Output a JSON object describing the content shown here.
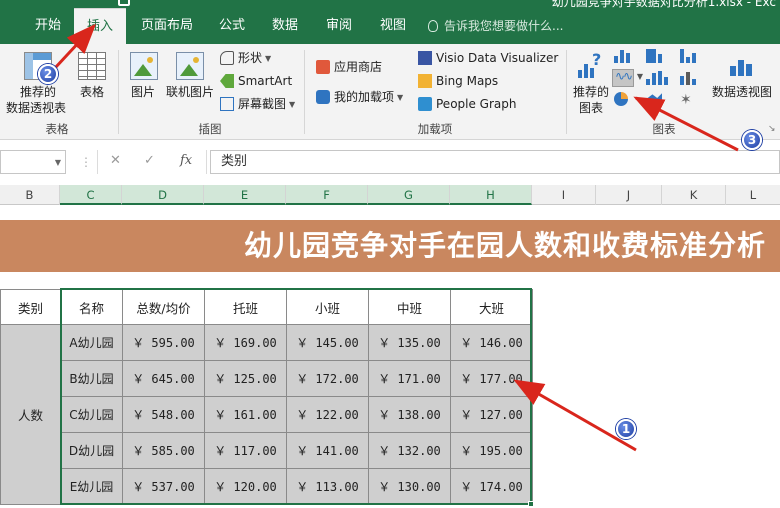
{
  "window": {
    "title": "幼儿园竞争对手数据对比分析1.xlsx - Exc"
  },
  "tabs": [
    "开始",
    "插入",
    "页面布局",
    "公式",
    "数据",
    "审阅",
    "视图"
  ],
  "active_tab": "插入",
  "tell_me": "告诉我您想要做什么...",
  "ribbon": {
    "tables": {
      "pivot_line1": "推荐的",
      "pivot_line2": "数据透视表",
      "table": "表格",
      "group": "表格"
    },
    "illustrations": {
      "picture": "图片",
      "online_picture": "联机图片",
      "shapes": "形状",
      "smartart": "SmartArt",
      "screenshot": "屏幕截图",
      "group": "插图"
    },
    "addins": {
      "store": "应用商店",
      "my_addins": "我的加载项",
      "visio": "Visio Data Visualizer",
      "bing": "Bing Maps",
      "people": "People Graph",
      "group": "加载项"
    },
    "charts": {
      "recommended_line1": "推荐的",
      "recommended_line2": "图表",
      "pivot_chart": "数据透视图",
      "group": "图表"
    }
  },
  "formula_bar": {
    "cell_ref": "",
    "content": "类别",
    "fx": "fx"
  },
  "columns": [
    "B",
    "C",
    "D",
    "E",
    "F",
    "G",
    "H",
    "I",
    "J",
    "K",
    "L"
  ],
  "banner": "幼儿园竞争对手在园人数和收费标准分析",
  "table": {
    "headers": [
      "类别",
      "名称",
      "总数/均价",
      "托班",
      "小班",
      "中班",
      "大班"
    ],
    "category": "人数",
    "rows": [
      {
        "name": "A幼儿园",
        "values": [
          "￥ 595.00",
          "￥ 169.00",
          "￥ 145.00",
          "￥ 135.00",
          "￥ 146.00"
        ]
      },
      {
        "name": "B幼儿园",
        "values": [
          "￥ 645.00",
          "￥ 125.00",
          "￥ 172.00",
          "￥ 171.00",
          "￥ 177.00"
        ]
      },
      {
        "name": "C幼儿园",
        "values": [
          "￥ 548.00",
          "￥ 161.00",
          "￥ 122.00",
          "￥ 138.00",
          "￥ 127.00"
        ]
      },
      {
        "name": "D幼儿园",
        "values": [
          "￥ 585.00",
          "￥ 117.00",
          "￥ 141.00",
          "￥ 132.00",
          "￥ 195.00"
        ]
      },
      {
        "name": "E幼儿园",
        "values": [
          "￥ 537.00",
          "￥ 120.00",
          "￥ 113.00",
          "￥ 130.00",
          "￥ 174.00"
        ]
      }
    ]
  },
  "annotations": [
    "1",
    "2",
    "3"
  ],
  "colors": {
    "excel_green": "#217346",
    "banner": "#c9875f",
    "cell_gray": "#cfcfcf",
    "arrow_red": "#d9261c",
    "callout_blue": "#1f3fa3"
  }
}
